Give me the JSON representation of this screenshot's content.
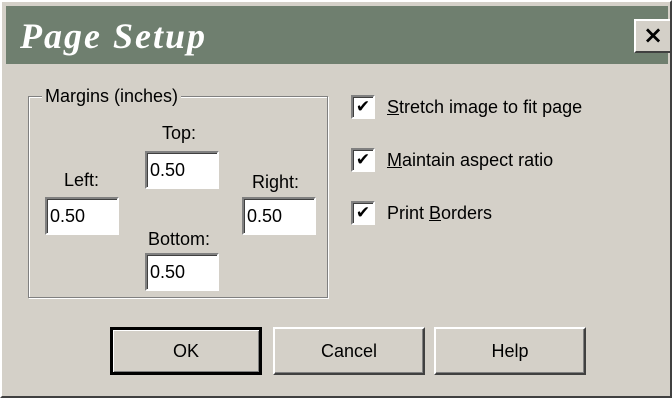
{
  "window": {
    "title": "Page Setup",
    "close_label": "×"
  },
  "margins": {
    "group_label": "Margins (inches)",
    "top_label": "Top:",
    "top_value": "0.50",
    "left_label": "Left:",
    "left_value": "0.50",
    "right_label": "Right:",
    "right_value": "0.50",
    "bottom_label": "Bottom:",
    "bottom_value": "0.50"
  },
  "options": [
    {
      "label_before": "",
      "label_underlined": "S",
      "label_after": "tretch image to fit page",
      "checked": true,
      "check_mark": "✔"
    },
    {
      "label_before": "",
      "label_underlined": "M",
      "label_after": "aintain aspect ratio",
      "checked": true,
      "check_mark": "✔"
    },
    {
      "label_before": "Print ",
      "label_underlined": "B",
      "label_after": "orders",
      "checked": true,
      "check_mark": "✔"
    }
  ],
  "buttons": {
    "ok_label": "OK",
    "cancel_label": "Cancel",
    "help_label": "Help"
  },
  "colors": {
    "titlebar": "#6f7f6f",
    "dialog_face": "#d4d0c8"
  }
}
